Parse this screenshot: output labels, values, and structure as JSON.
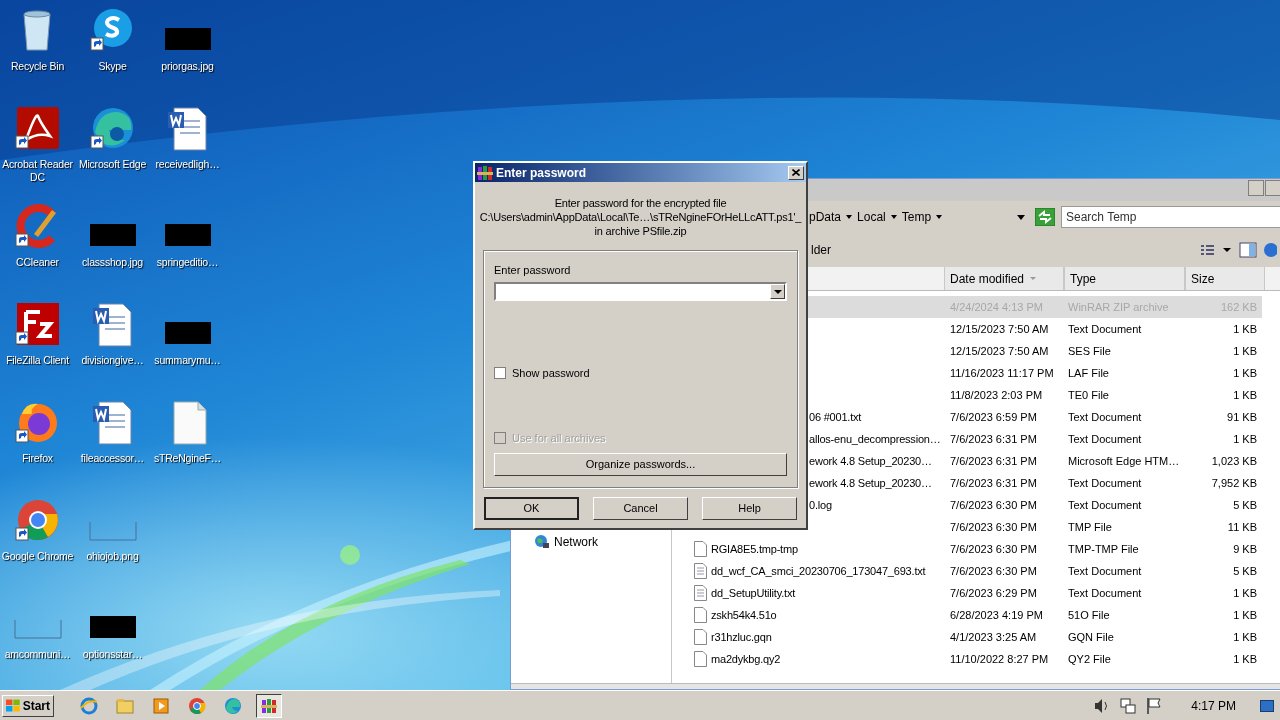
{
  "desktop_columns": [
    [
      {
        "label": "Recycle Bin",
        "kind": "recycle_bin",
        "shortcut": false
      },
      {
        "label": "Acrobat Reader DC",
        "kind": "acrobat",
        "shortcut": true
      },
      {
        "label": "CCleaner",
        "kind": "ccleaner",
        "shortcut": true
      },
      {
        "label": "FileZilla Client",
        "kind": "filezilla",
        "shortcut": true
      },
      {
        "label": "Firefox",
        "kind": "firefox",
        "shortcut": true
      },
      {
        "label": "Google Chrome",
        "kind": "chrome",
        "shortcut": true
      },
      {
        "label": "amcommuni…",
        "kind": "empty_thumb",
        "shortcut": false
      }
    ],
    [
      {
        "label": "Skype",
        "kind": "skype",
        "shortcut": true
      },
      {
        "label": "Microsoft Edge",
        "kind": "edge",
        "shortcut": true
      },
      {
        "label": "classshop.jpg",
        "kind": "dark_thumb",
        "shortcut": false
      },
      {
        "label": "divisiongive…",
        "kind": "word_doc",
        "shortcut": false
      },
      {
        "label": "fileaccessor…",
        "kind": "word_doc",
        "shortcut": false
      },
      {
        "label": "ohiojob.png",
        "kind": "empty_thumb",
        "shortcut": false
      },
      {
        "label": "optionsstar…",
        "kind": "dark_thumb",
        "shortcut": false
      }
    ],
    [
      {
        "label": "priorgas.jpg",
        "kind": "dark_thumb",
        "shortcut": false
      },
      {
        "label": "receivedligh…",
        "kind": "word_doc",
        "shortcut": false
      },
      {
        "label": "springeditio…",
        "kind": "dark_thumb",
        "shortcut": false
      },
      {
        "label": "summarymu…",
        "kind": "dark_thumb",
        "shortcut": false
      },
      {
        "label": "sTReNgineF…",
        "kind": "blank_doc",
        "shortcut": false
      }
    ]
  ],
  "explorer": {
    "breadcrumb": [
      "pData",
      "Local",
      "Temp"
    ],
    "search": {
      "placeholder": "Search Temp"
    },
    "toolbar_fragment": "lder",
    "nav_items": [
      "Network"
    ],
    "columns": [
      "Date modified",
      "Type",
      "Size"
    ],
    "rows": [
      {
        "kind": "covered",
        "date": "4/24/2024 4:13 PM",
        "type": "WinRAR ZIP archive",
        "size": "162 KB",
        "selected": true
      },
      {
        "kind": "covered",
        "date": "12/15/2023 7:50 AM",
        "type": "Text Document",
        "size": "1 KB",
        "selected": false
      },
      {
        "kind": "covered",
        "date": "12/15/2023 7:50 AM",
        "type": "SES File",
        "size": "1 KB",
        "selected": false
      },
      {
        "kind": "covered",
        "date": "11/16/2023 11:17 PM",
        "type": "LAF File",
        "size": "1 KB",
        "selected": false
      },
      {
        "kind": "covered",
        "date": "11/8/2023 2:03 PM",
        "type": "TE0 File",
        "size": "1 KB",
        "selected": false
      },
      {
        "kind": "covered",
        "name": "06 #001.txt",
        "date": "7/6/2023 6:59 PM",
        "type": "Text Document",
        "size": "91 KB",
        "selected": false
      },
      {
        "kind": "covered",
        "name": "allos-enu_decompression…",
        "date": "7/6/2023 6:31 PM",
        "type": "Text Document",
        "size": "1 KB",
        "selected": false
      },
      {
        "kind": "covered",
        "name": "ework 4.8 Setup_20230…",
        "date": "7/6/2023 6:31 PM",
        "type": "Microsoft Edge HTM…",
        "size": "1,023 KB",
        "selected": false
      },
      {
        "kind": "covered",
        "name": "ework 4.8 Setup_20230…",
        "date": "7/6/2023 6:31 PM",
        "type": "Text Document",
        "size": "7,952 KB",
        "selected": false
      },
      {
        "kind": "covered",
        "name": "0.log",
        "date": "7/6/2023 6:30 PM",
        "type": "Text Document",
        "size": "5 KB",
        "selected": false
      },
      {
        "kind": "covered",
        "date": "7/6/2023 6:30 PM",
        "type": "TMP File",
        "size": "11 KB",
        "selected": false
      },
      {
        "kind": "file",
        "name": "RGIA8E5.tmp-tmp",
        "date": "7/6/2023 6:30 PM",
        "type": "TMP-TMP File",
        "size": "9 KB",
        "selected": false
      },
      {
        "kind": "text_file",
        "name": "dd_wcf_CA_smci_20230706_173047_693.txt",
        "date": "7/6/2023 6:30 PM",
        "type": "Text Document",
        "size": "5 KB",
        "selected": false
      },
      {
        "kind": "text_file",
        "name": "dd_SetupUtility.txt",
        "date": "7/6/2023 6:29 PM",
        "type": "Text Document",
        "size": "1 KB",
        "selected": false
      },
      {
        "kind": "file",
        "name": "zskh54k4.51o",
        "date": "6/28/2023 4:19 PM",
        "type": "51O File",
        "size": "1 KB",
        "selected": false
      },
      {
        "kind": "file",
        "name": "r31hzluc.gqn",
        "date": "4/1/2023 3:25 AM",
        "type": "GQN File",
        "size": "1 KB",
        "selected": false
      },
      {
        "kind": "file",
        "name": "ma2dykbg.qy2",
        "date": "11/10/2022 8:27 PM",
        "type": "QY2 File",
        "size": "1 KB",
        "selected": false
      }
    ]
  },
  "dialog": {
    "title": "Enter password",
    "message": [
      "Enter password for the encrypted file",
      "C:\\Users\\admin\\AppData\\Local\\Te…\\sTReNgineFOrHeLLcATT.ps1'_",
      "in archive PSfile.zip"
    ],
    "field_label": "Enter password",
    "show_password": {
      "label": "Show password",
      "checked": false,
      "disabled": false
    },
    "use_for_all": {
      "label": "Use for all archives",
      "checked": false,
      "disabled": true
    },
    "organize_button": "Organize passwords...",
    "buttons": [
      {
        "label": "OK",
        "default": true
      },
      {
        "label": "Cancel",
        "default": false
      },
      {
        "label": "Help",
        "default": false
      }
    ]
  },
  "taskbar": {
    "start": "Start",
    "clock": "4:17 PM",
    "apps": [
      {
        "kind": "ie",
        "active": false
      },
      {
        "kind": "folder",
        "active": false
      },
      {
        "kind": "media",
        "active": false
      },
      {
        "kind": "chrome",
        "active": false
      },
      {
        "kind": "edge",
        "active": false
      },
      {
        "kind": "winrar",
        "active": true
      }
    ]
  }
}
